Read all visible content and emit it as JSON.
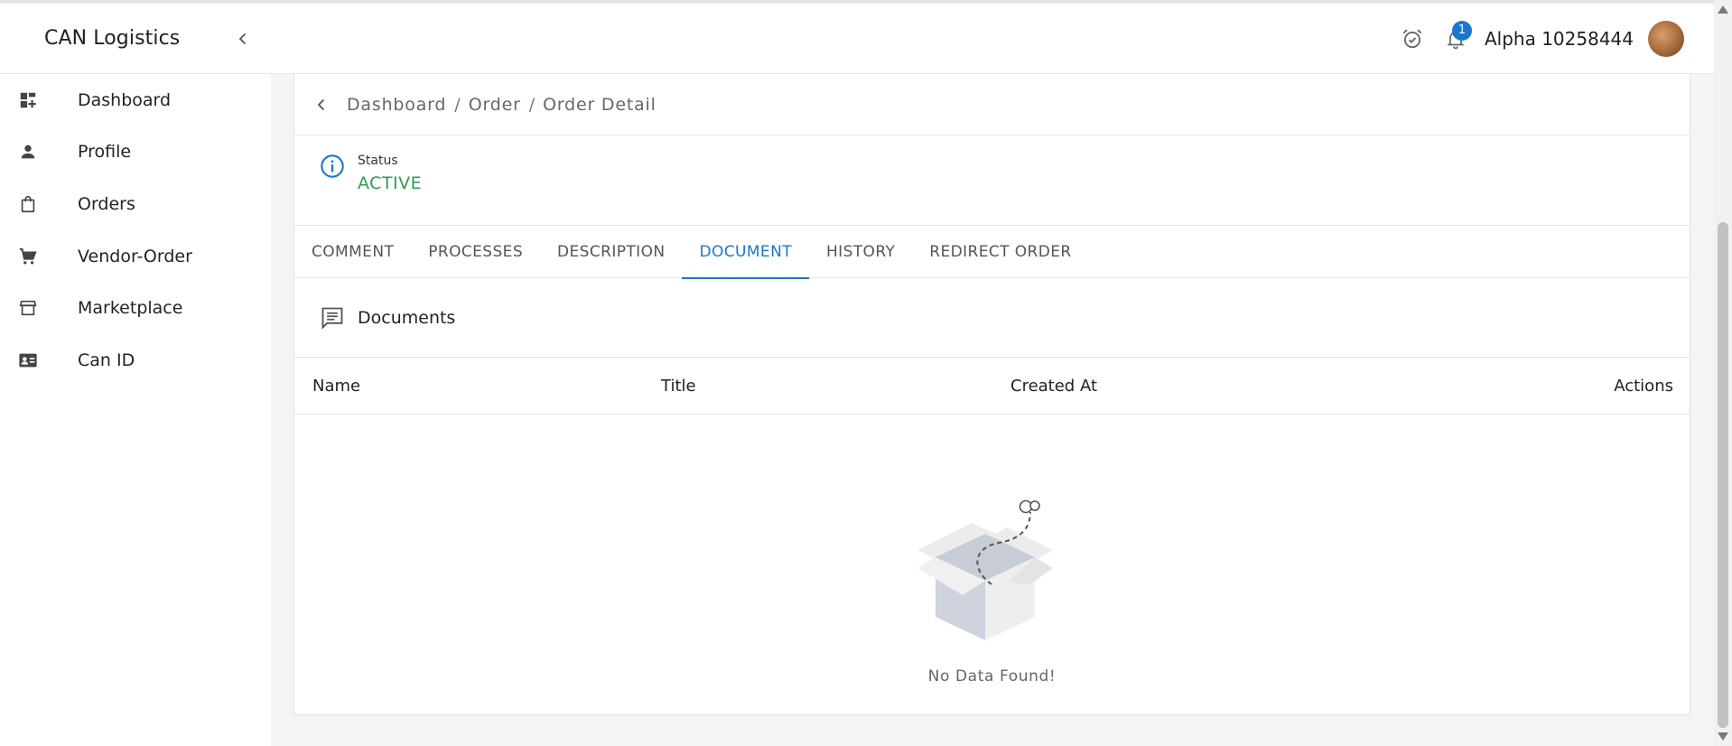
{
  "app": {
    "brand": "CAN Logistics"
  },
  "header": {
    "username": "Alpha 10258444",
    "notification_count": "1"
  },
  "sidebar": {
    "items": [
      {
        "label": "Dashboard",
        "icon": "dashboard-icon"
      },
      {
        "label": "Profile",
        "icon": "person-icon"
      },
      {
        "label": "Orders",
        "icon": "shopping-bag-icon"
      },
      {
        "label": "Vendor-Order",
        "icon": "cart-icon"
      },
      {
        "label": "Marketplace",
        "icon": "store-icon"
      },
      {
        "label": "Can ID",
        "icon": "id-card-icon"
      }
    ]
  },
  "breadcrumb": [
    "Dashboard",
    "Order",
    "Order Detail"
  ],
  "breadcrumb_sep": "/",
  "status": {
    "label": "Status",
    "value": "ACTIVE",
    "value_color": "#2e9b51"
  },
  "tabs": [
    {
      "label": "COMMENT"
    },
    {
      "label": "PROCESSES"
    },
    {
      "label": "DESCRIPTION"
    },
    {
      "label": "DOCUMENT",
      "active": true
    },
    {
      "label": "HISTORY"
    },
    {
      "label": "REDIRECT ORDER"
    }
  ],
  "documents": {
    "title": "Documents",
    "columns": [
      "Name",
      "Title",
      "Created At",
      "Actions"
    ],
    "empty_text": "No Data Found!"
  },
  "colors": {
    "accent": "#1976d2",
    "status_active": "#2e9b51"
  }
}
